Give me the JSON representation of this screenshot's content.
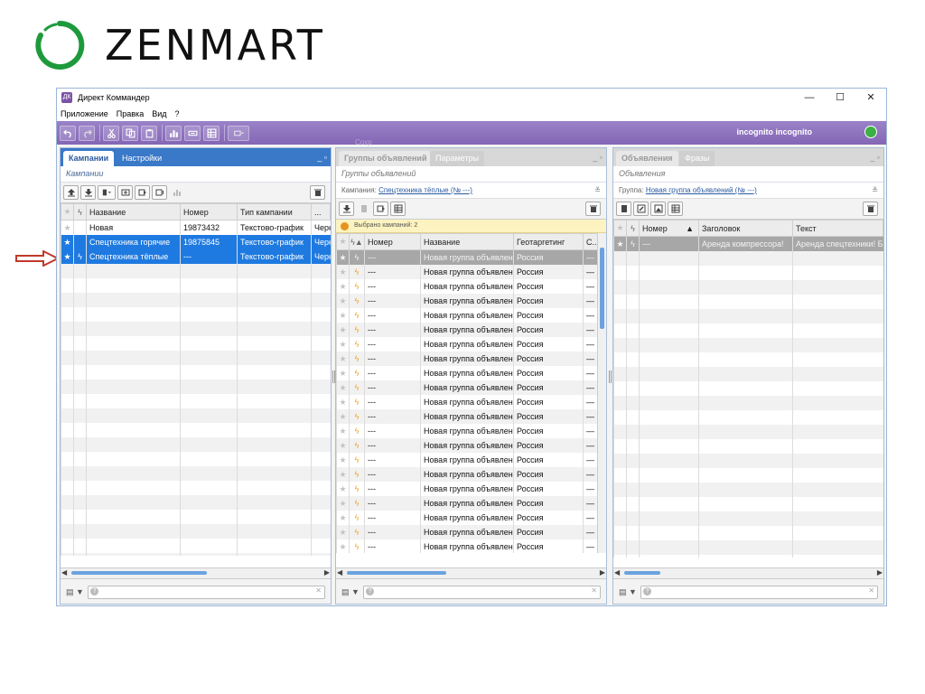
{
  "brand": {
    "name": "ZENMART",
    "ring_color": "#1e9a3c"
  },
  "window": {
    "title": "Директ Коммандер",
    "controls": {
      "minimize": "—",
      "maximize": "☐",
      "close": "✕"
    }
  },
  "menu": [
    "Приложение",
    "Правка",
    "Вид",
    "?"
  ],
  "toolbar": {
    "user": "incognito incognito",
    "faded_label": "Сохр",
    "accent": "#8a6dbb",
    "buttons": [
      "undo-icon",
      "redo-icon",
      "cut-icon",
      "copy-icon",
      "paste-icon",
      "chart-icon",
      "keyword-icon",
      "table-icon",
      "layout-icon"
    ]
  },
  "campaigns": {
    "tabs": [
      "Кампании",
      "Настройки"
    ],
    "subtitle": "Кампании",
    "columns": [
      "Название",
      "Номер",
      "Тип кампании",
      "..."
    ],
    "rows": [
      {
        "name": "Новая",
        "number": "19873432",
        "type": "Текстово-график",
        "extra": "Черн",
        "state": "normal"
      },
      {
        "name": "Спецтехника горячие",
        "number": "19875845",
        "type": "Текстово-график",
        "extra": "Черн",
        "state": "selected"
      },
      {
        "name": "Спецтехника тёплые",
        "number": "---",
        "type": "Текстово-график",
        "extra": "Черн",
        "state": "selected"
      }
    ]
  },
  "groups": {
    "tabs": [
      "Группы объявлений",
      "Параметры"
    ],
    "subtitle": "Группы объявлений",
    "filter_label": "Кампания:",
    "filter_value": "Спецтехника тёплые (№ ---)",
    "notice": "Выбрано кампаний: 2",
    "columns": [
      "Номер",
      "Название",
      "Геотаргетинг",
      "С..."
    ],
    "row_number": "---",
    "row_name": "Новая группа объявлен",
    "row_geo": "Россия",
    "row_c": "—",
    "row_count": 24
  },
  "ads": {
    "tabs": [
      "Объявления",
      "Фразы"
    ],
    "subtitle": "Объявления",
    "filter_label": "Группа:",
    "filter_value": "Новая группа объявлений (№ ---)",
    "columns": [
      "Номер",
      "Заголовок",
      "Текст"
    ],
    "sort_indicator": "▲",
    "rows": [
      {
        "number": "---",
        "title": "Аренда компрессора!",
        "text": "Аренда спецтехники! Б"
      }
    ]
  }
}
